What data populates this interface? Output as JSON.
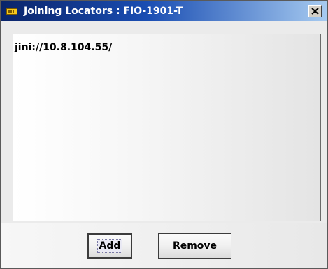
{
  "window": {
    "title": "Joining Locators : FIO-1901-T",
    "icon": "window-app-icon",
    "close_icon": "close-icon"
  },
  "list": {
    "items": [
      "jini://10.8.104.55/"
    ]
  },
  "buttons": {
    "add_label": "Add",
    "remove_label": "Remove"
  }
}
